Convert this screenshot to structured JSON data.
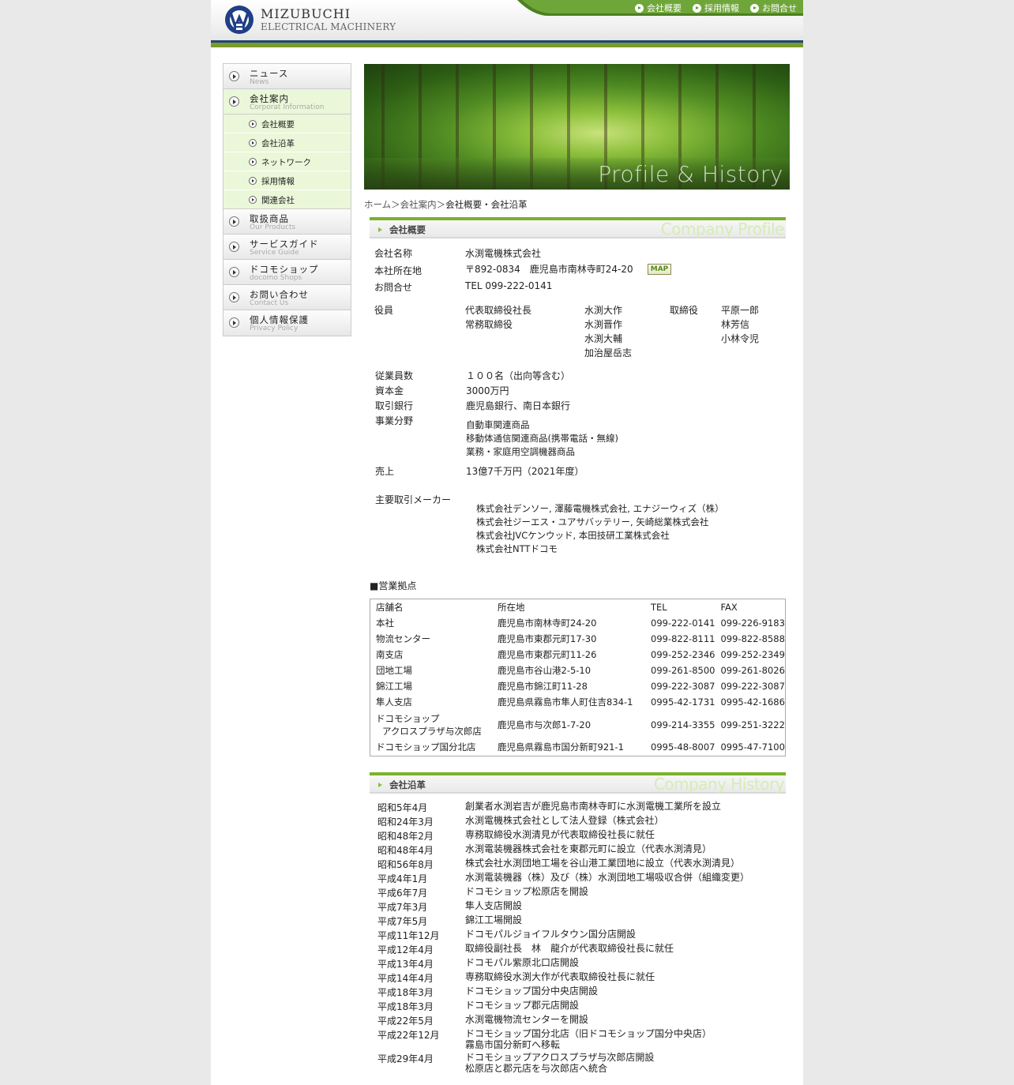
{
  "header": {
    "logo_line1": "MIZUBUCHI",
    "logo_line2": "ELECTRICAL MACHINERY",
    "nav": [
      "会社概要",
      "採用情報",
      "お問合せ"
    ]
  },
  "sidebar": {
    "items": [
      {
        "jp": "ニュース",
        "en": "News"
      },
      {
        "jp": "会社案内",
        "en": "Corporat Information"
      },
      {
        "jp": "取扱商品",
        "en": "Our Products"
      },
      {
        "jp": "サービスガイド",
        "en": "Service Guide"
      },
      {
        "jp": "ドコモショップ",
        "en": "docomo Shops"
      },
      {
        "jp": "お問い合わせ",
        "en": "Contact Us"
      },
      {
        "jp": "個人情報保護",
        "en": "Privacy Policy"
      }
    ],
    "sub": [
      "会社概要",
      "会社沿革",
      "ネットワーク",
      "採用情報",
      "関連会社"
    ]
  },
  "hero": {
    "caption": "Profile & History"
  },
  "breadcrumb": {
    "home": "ホーム",
    "sep": "＞",
    "parent": "会社案内",
    "current": "会社概要・会社沿革"
  },
  "profile": {
    "heading": "会社概要",
    "heading_en": "Company Profile",
    "name_label": "会社名称",
    "name": "水渕電機株式会社",
    "addr_label": "本社所在地",
    "addr": "〒892-0834　鹿児島市南林寺町24-20",
    "map": "MAP",
    "contact_label": "お問合せ",
    "contact": "TEL 099-222-0141",
    "officers_label": "役員",
    "officer_titles": [
      "代表取締役社長",
      "常務取締役"
    ],
    "officers_a": [
      "水渕大作",
      "水渕晋作",
      "水渕大輔",
      "加治屋岳志"
    ],
    "director_label": "取締役",
    "officers_b": [
      "平原一郎",
      "林芳信",
      "小林令児"
    ],
    "employees_label": "従業員数",
    "employees": "１００名（出向等含む）",
    "capital_label": "資本金",
    "capital": "3000万円",
    "bank_label": "取引銀行",
    "bank": "鹿児島銀行、南日本銀行",
    "field_label": "事業分野",
    "fields": [
      "自動車関連商品",
      "移動体通信関連商品(携帯電話・無線)",
      "業務・家庭用空調機器商品"
    ],
    "sales_label": "売上",
    "sales": "13億7千万円（2021年度）",
    "makers_label": "主要取引メーカー",
    "makers": [
      "株式会社デンソー, 澤藤電機株式会社, エナジーウィズ（株）",
      "株式会社ジーエス・ユアサバッテリー, 矢崎総業株式会社",
      "株式会社JVCケンウッド, 本田技研工業株式会社",
      "株式会社NTTドコモ"
    ]
  },
  "branches": {
    "heading": "■営業拠点",
    "columns": [
      "店舗名",
      "所在地",
      "TEL",
      "FAX"
    ],
    "rows": [
      [
        "本社",
        "鹿児島市南林寺町24-20",
        "099-222-0141",
        "099-226-9183"
      ],
      [
        "物流センター",
        "鹿児島市東郡元町17-30",
        "099-822-8111",
        "099-822-8588"
      ],
      [
        "南支店",
        "鹿児島市東郡元町11-26",
        "099-252-2346",
        "099-252-2349"
      ],
      [
        "団地工場",
        "鹿児島市谷山港2-5-10",
        "099-261-8500",
        "099-261-8026"
      ],
      [
        "錦江工場",
        "鹿児島市錦江町11-28",
        "099-222-3087",
        "099-222-3087"
      ],
      [
        "隼人支店",
        "鹿児島県霧島市隼人町住吉834-1",
        "0995-42-1731",
        "0995-42-1686"
      ],
      [
        "ドコモショップ",
        "鹿児島市与次郎1-7-20",
        "099-214-3355",
        "099-251-3222"
      ],
      [
        "ドコモショップ国分北店",
        "鹿児島県霧島市国分新町921-1",
        "0995-48-8007",
        "0995-47-7100"
      ]
    ],
    "row7_line2": "アクロスプラザ与次郎店"
  },
  "history": {
    "heading": "会社沿革",
    "heading_en": "Company History",
    "rows": [
      [
        "昭和5年4月",
        "創業者水渕岩吉が鹿児島市南林寺町に水渕電機工業所を設立",
        ""
      ],
      [
        "昭和24年3月",
        "水渕電機株式会社として法人登録（株式会社）",
        ""
      ],
      [
        "昭和48年2月",
        "専務取締役水渕清見が代表取締役社長に就任",
        ""
      ],
      [
        "昭和48年4月",
        "水渕電装機器株式会社を東郡元町に設立（代表水渕清見）",
        ""
      ],
      [
        "昭和56年8月",
        "株式会社水渕団地工場を谷山港工業団地に設立（代表水渕清見）",
        ""
      ],
      [
        "平成4年1月",
        "水渕電装機器（株）及び（株）水渕団地工場吸収合併（組織変更）",
        ""
      ],
      [
        "平成6年7月",
        "ドコモショップ松原店を開設",
        ""
      ],
      [
        "平成7年3月",
        "隼人支店開設",
        ""
      ],
      [
        "平成7年5月",
        "錦江工場開設",
        ""
      ],
      [
        "平成11年12月",
        "ドコモパルジョイフルタウン国分店開設",
        ""
      ],
      [
        "平成12年4月",
        "取締役副社長　林　龍介が代表取締役社長に就任",
        ""
      ],
      [
        "平成13年4月",
        "ドコモパル紫原北口店開設",
        ""
      ],
      [
        "平成14年4月",
        "専務取締役水渕大作が代表取締役社長に就任",
        ""
      ],
      [
        "平成18年3月",
        "ドコモショップ国分中央店開設",
        ""
      ],
      [
        "平成18年3月",
        "ドコモショップ郡元店開設",
        ""
      ],
      [
        "平成22年5月",
        "水渕電機物流センターを開設",
        ""
      ],
      [
        "平成22年12月",
        "ドコモショップ国分北店（旧ドコモショップ国分中央店）",
        "霧島市国分新町へ移転"
      ],
      [
        "平成29年4月",
        "ドコモショップアクロスプラザ与次郎店開設",
        "松原店と郡元店を与次郎店へ統合"
      ]
    ]
  }
}
